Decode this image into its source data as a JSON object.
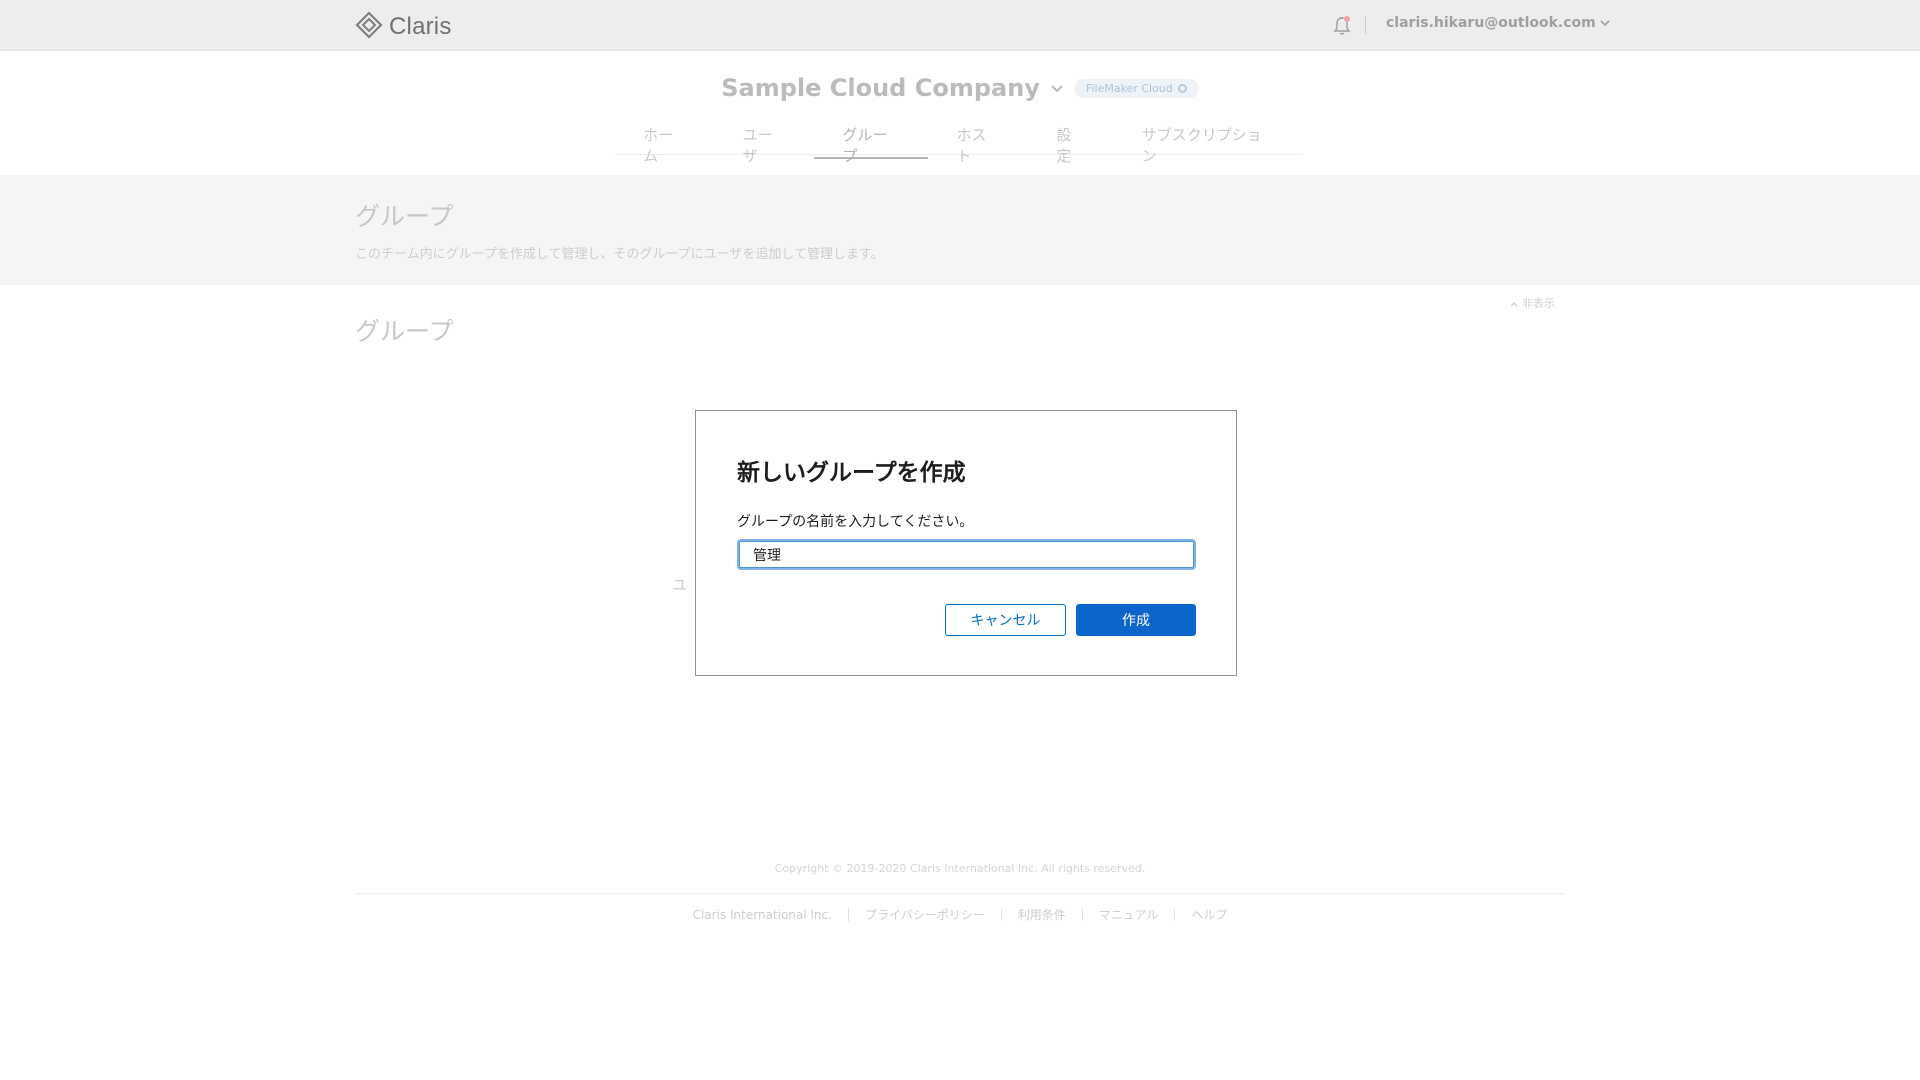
{
  "header": {
    "brand": "Claris",
    "user_email": "claris.hikaru@outlook.com",
    "icons": [
      "claris-logo-icon",
      "bell-icon",
      "chevron-down-icon"
    ]
  },
  "company": {
    "name": "Sample Cloud Company",
    "badge": "FileMaker Cloud"
  },
  "nav": {
    "tabs": [
      {
        "label": "ホーム",
        "active": false
      },
      {
        "label": "ユーザ",
        "active": false
      },
      {
        "label": "グループ",
        "active": true
      },
      {
        "label": "ホスト",
        "active": false
      },
      {
        "label": "設定",
        "active": false
      },
      {
        "label": "サブスクリプション",
        "active": false
      }
    ]
  },
  "hero": {
    "title": "グループ",
    "description": "このチーム内にグループを作成して管理し、そのグループにユーザを追加して管理します。"
  },
  "main": {
    "hide_label": "非表示",
    "section_title": "グループ",
    "ghost_text": "ユ"
  },
  "dialog": {
    "title": "新しいグループを作成",
    "prompt": "グループの名前を入力してください。",
    "input_value": "管理",
    "cancel_label": "キャンセル",
    "create_label": "作成"
  },
  "footer": {
    "copyright": "Copyright © 2019-2020 Claris International Inc. All rights reserved.",
    "links": [
      "Claris International Inc.",
      "プライバシーポリシー",
      "利用条件",
      "マニュアル",
      "ヘルプ"
    ]
  },
  "colors": {
    "primary": "#0a66c8",
    "topbar": "#ececec",
    "focus_ring": "#4a90d9"
  }
}
